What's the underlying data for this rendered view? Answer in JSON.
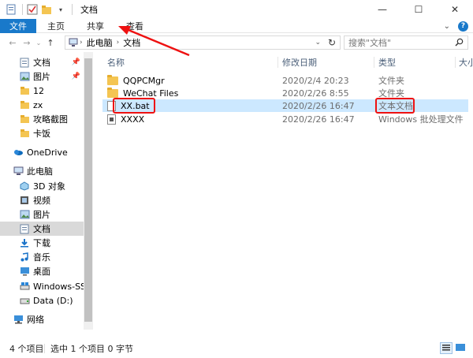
{
  "window": {
    "title": "文档",
    "buttons": [
      "—",
      "☐",
      "✕"
    ]
  },
  "ribbon": {
    "file_tab": "文件",
    "tabs": [
      "主页",
      "共享",
      "查看"
    ],
    "help_label": "?"
  },
  "nav": {
    "breadcrumb": [
      "此电脑",
      "文档"
    ],
    "search_placeholder": "搜索\"文档\""
  },
  "sidebar": {
    "items": [
      {
        "label": "文档",
        "icon": "documents-icon",
        "pinned": true
      },
      {
        "label": "图片",
        "icon": "pictures-icon",
        "pinned": true
      },
      {
        "label": "12",
        "icon": "folder-icon"
      },
      {
        "label": "zx",
        "icon": "folder-icon"
      },
      {
        "label": "攻略截图",
        "icon": "folder-icon"
      },
      {
        "label": "卡饭",
        "icon": "folder-icon"
      },
      {
        "label": "OneDrive",
        "icon": "onedrive-icon"
      },
      {
        "label": "此电脑",
        "icon": "this-pc-icon"
      },
      {
        "label": "3D 对象",
        "icon": "3d-objects-icon"
      },
      {
        "label": "视频",
        "icon": "videos-icon"
      },
      {
        "label": "图片",
        "icon": "pictures-icon"
      },
      {
        "label": "文档",
        "icon": "documents-icon",
        "selected": true
      },
      {
        "label": "下载",
        "icon": "downloads-icon"
      },
      {
        "label": "音乐",
        "icon": "music-icon"
      },
      {
        "label": "桌面",
        "icon": "desktop-icon"
      },
      {
        "label": "Windows-SSD (",
        "icon": "drive-icon"
      },
      {
        "label": "Data (D:)",
        "icon": "drive-icon"
      },
      {
        "label": "网络",
        "icon": "network-icon"
      }
    ]
  },
  "columns": {
    "name": "名称",
    "date": "修改日期",
    "type": "类型",
    "size": "大小"
  },
  "files": [
    {
      "name": "QQPCMgr",
      "date": "2020/2/4 20:23",
      "type": "文件夹",
      "kind": "folder"
    },
    {
      "name": "WeChat Files",
      "date": "2020/2/26 8:55",
      "type": "文件夹",
      "kind": "folder"
    },
    {
      "name": "XX.bat",
      "date": "2020/2/26 16:47",
      "type": "文本文档",
      "kind": "text",
      "selected": true
    },
    {
      "name": "XXXX",
      "date": "2020/2/26 16:47",
      "type": "Windows 批处理文件",
      "kind": "bat"
    }
  ],
  "status": {
    "item_count": "4 个项目",
    "selection": "选中 1 个项目  0 字节"
  },
  "colors": {
    "accent": "#1979ca",
    "selection": "#cce8ff",
    "annotation": "#e11111"
  }
}
